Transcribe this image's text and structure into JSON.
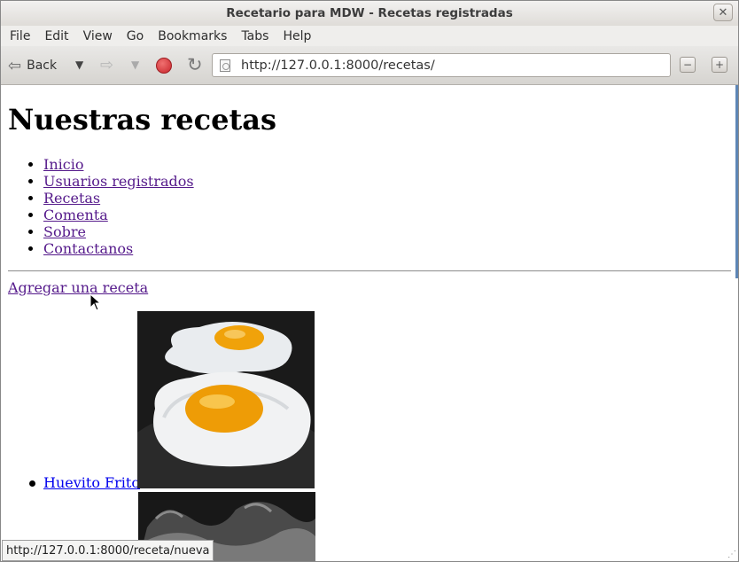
{
  "window": {
    "title": "Recetario para MDW - Recetas registradas"
  },
  "menu": [
    "File",
    "Edit",
    "View",
    "Go",
    "Bookmarks",
    "Tabs",
    "Help"
  ],
  "toolbar": {
    "back_label": "Back",
    "url": "http://127.0.0.1:8000/recetas/"
  },
  "page": {
    "heading": "Nuestras recetas",
    "nav_links": [
      "Inicio",
      "Usuarios registrados",
      "Recetas",
      "Comenta",
      "Sobre",
      "Contactanos"
    ],
    "add_link": "Agregar una receta",
    "recipes": [
      {
        "name": "Huevito Frito",
        "image": "fried-eggs-photo"
      },
      {
        "name": "",
        "image": "steam-photo"
      }
    ]
  },
  "status": {
    "text": "http://127.0.0.1:8000/receta/nueva"
  },
  "colors": {
    "visited_link": "#551a8b",
    "link": "#0000ee",
    "stop": "#c8262c",
    "scroll_accent": "#5e86b6"
  }
}
